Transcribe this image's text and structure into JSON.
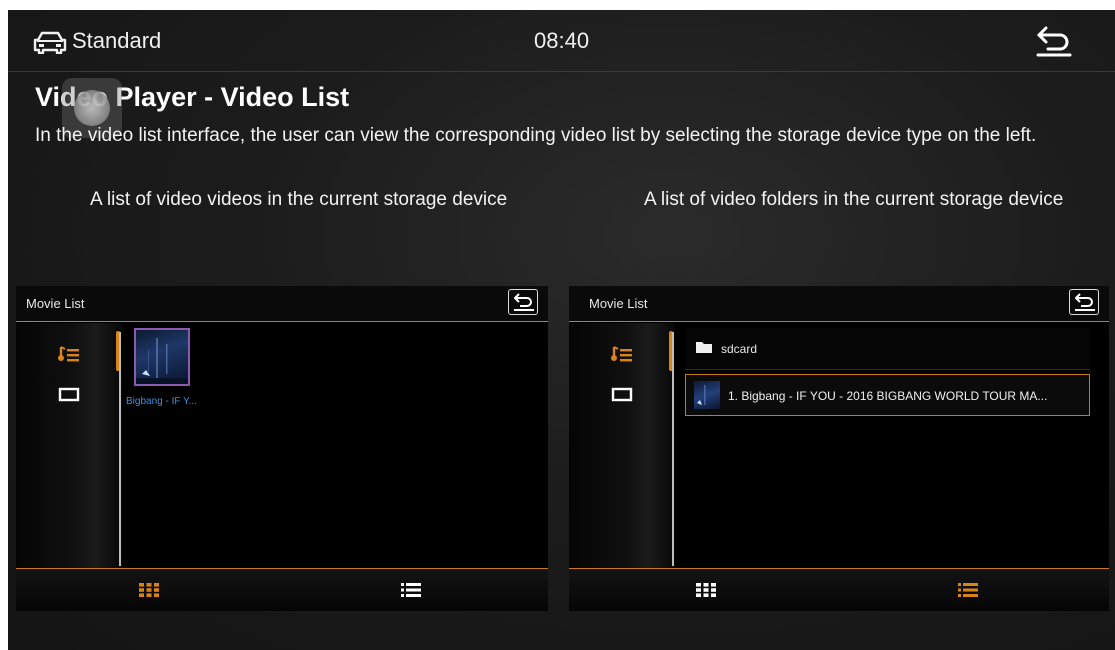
{
  "statusbar": {
    "mode": "Standard",
    "time": "08:40",
    "car_icon": "car-icon",
    "back_icon": "back-arrow-icon"
  },
  "page": {
    "title": "Video Player - Video List",
    "intro": "In the video list interface, the user can view the corresponding video list by selecting the storage device type on the left.",
    "caption_left": "A list of video videos in the current storage device",
    "caption_right": "A list of video folders in the current storage device"
  },
  "left_panel": {
    "title": "Movie List",
    "side_items": [
      {
        "icon": "music-list-icon",
        "active": true
      },
      {
        "icon": "screen-icon",
        "active": false
      }
    ],
    "videos": [
      {
        "label": "Bigbang - IF Y..."
      }
    ],
    "bottom_tabs": [
      {
        "icon": "grid-view-icon",
        "active": true
      },
      {
        "icon": "list-view-icon",
        "active": false
      }
    ]
  },
  "right_panel": {
    "title": "Movie List",
    "side_items": [
      {
        "icon": "music-list-icon",
        "active": true
      },
      {
        "icon": "screen-icon",
        "active": false
      }
    ],
    "folder": {
      "label": "sdcard",
      "icon": "folder-icon"
    },
    "files": [
      {
        "label": "1.  Bigbang - IF YOU - 2016 BIGBANG WORLD TOUR MA..."
      }
    ],
    "bottom_tabs": [
      {
        "icon": "grid-view-icon",
        "active": false
      },
      {
        "icon": "list-view-icon",
        "active": true
      }
    ]
  },
  "colors": {
    "accent": "#d88418",
    "link": "#3b8fe0",
    "background": "#1c1c1c"
  }
}
